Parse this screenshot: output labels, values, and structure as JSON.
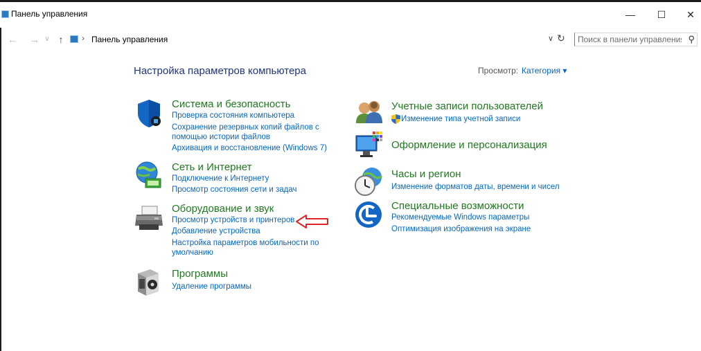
{
  "window": {
    "title": "Панель управления",
    "minimize": "—",
    "maximize": "☐",
    "close": "✕"
  },
  "address": {
    "back": "←",
    "forward": "→",
    "history": "∨",
    "up": "↑",
    "separator": "›",
    "path": "Панель управления",
    "dropdown": "∨",
    "refresh": "↻",
    "search_placeholder": "Поиск в панели управления",
    "search_icon": "⚲"
  },
  "main": {
    "heading": "Настройка параметров компьютера",
    "view_label": "Просмотр:",
    "view_value": "Категория ▾"
  },
  "categories_left": [
    {
      "icon": "shield-icon",
      "title": "Система и безопасность",
      "links": [
        "Проверка состояния компьютера",
        "Сохранение резервных копий файлов с",
        "помощью истории файлов",
        "Архивация и восстановление (Windows 7)"
      ]
    },
    {
      "icon": "network-globe-icon",
      "title": "Сеть и Интернет",
      "links": [
        "Подключение к Интернету",
        "Просмотр состояния сети и задач"
      ]
    },
    {
      "icon": "printer-icon",
      "title": "Оборудование и звук",
      "links": [
        "Просмотр устройств и принтеров",
        "Добавление устройства",
        "Настройка параметров мобильности по",
        "умолчанию"
      ]
    },
    {
      "icon": "programs-box-icon",
      "title": "Программы",
      "links": [
        "Удаление программы"
      ]
    }
  ],
  "categories_right": [
    {
      "icon": "users-icon",
      "title": "Учетные записи пользователей",
      "links": [
        "Изменение типа учетной записи"
      ]
    },
    {
      "icon": "monitor-palette-icon",
      "title": "Оформление и персонализация",
      "links": []
    },
    {
      "icon": "clock-globe-icon",
      "title": "Часы и регион",
      "links": [
        "Изменение форматов даты, времени и чисел"
      ]
    },
    {
      "icon": "accessibility-icon",
      "title": "Специальные возможности",
      "links": [
        "Рекомендуемые Windows параметры",
        "Оптимизация изображения на экране"
      ]
    }
  ],
  "colors": {
    "heading": "#1e3287",
    "category_title": "#1e7a1e",
    "link": "#0066cc",
    "annotation_arrow": "#e0242a"
  }
}
